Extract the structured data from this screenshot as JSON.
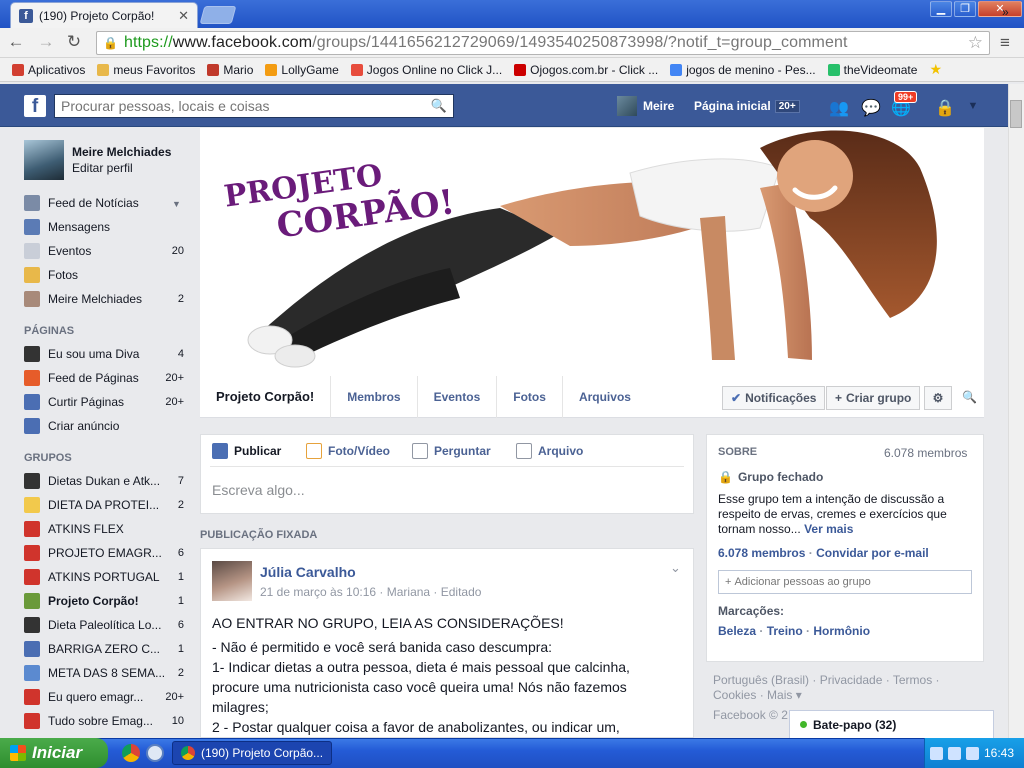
{
  "browser": {
    "tab_title": "(190) Projeto Corpão!",
    "url_https": "https://",
    "url_domain": "www.facebook.com",
    "url_path": "/groups/1441656212729069/1493540250873998/?notif_t=group_comment",
    "bookmarks": [
      {
        "label": "Aplicativos",
        "color": "#d23f31"
      },
      {
        "label": "meus Favoritos",
        "color": "#e8b84a"
      },
      {
        "label": "Mario",
        "color": "#c0392b"
      },
      {
        "label": "LollyGame",
        "color": "#f39c12"
      },
      {
        "label": "Jogos Online no Click J...",
        "color": "#e74c3c"
      },
      {
        "label": "Ojogos.com.br - Click ...",
        "color": "#cc0000"
      },
      {
        "label": "jogos de menino - Pes...",
        "color": "#4285f4"
      },
      {
        "label": "theVideomate",
        "color": "#27c06a"
      }
    ],
    "bookmarks_more": "»"
  },
  "fb": {
    "search_placeholder": "Procurar pessoas, locais e coisas",
    "user_short": "Meire",
    "home_label": "Página inicial",
    "home_count": "20+",
    "notif_badge": "99+"
  },
  "sidebar": {
    "name": "Meire Melchiades",
    "edit": "Editar perfil",
    "main": [
      {
        "label": "Feed de Notícias",
        "count": "",
        "icon": "news-feed-icon",
        "color": "#7b8ba6"
      },
      {
        "label": "Mensagens",
        "count": "",
        "icon": "messages-icon",
        "color": "#5b7bb5"
      },
      {
        "label": "Eventos",
        "count": "20",
        "icon": "calendar-icon",
        "color": "#c9ced8"
      },
      {
        "label": "Fotos",
        "count": "",
        "icon": "photos-icon",
        "color": "#e8b84a"
      },
      {
        "label": "Meire Melchiades",
        "count": "2",
        "icon": "profile-icon",
        "color": "#a88a7a"
      }
    ],
    "pages_head": "PÁGINAS",
    "pages": [
      {
        "label": "Eu sou uma Diva",
        "count": "4",
        "icon": "page-diva-icon",
        "color": "#333333"
      },
      {
        "label": "Feed de Páginas",
        "count": "20+",
        "icon": "flag-icon",
        "color": "#e65c2a"
      },
      {
        "label": "Curtir Páginas",
        "count": "20+",
        "icon": "like-icon",
        "color": "#4b6eb3"
      },
      {
        "label": "Criar anúncio",
        "count": "",
        "icon": "chart-icon",
        "color": "#4b6eb3"
      }
    ],
    "groups_head": "GRUPOS",
    "groups": [
      {
        "label": "Dietas Dukan e Atk...",
        "count": "7",
        "icon": "graduation-cap-icon",
        "color": "#333333",
        "bold": false
      },
      {
        "label": "DIETA DA PROTEI...",
        "count": "2",
        "icon": "lightbulb-icon",
        "color": "#f2c94c",
        "bold": false
      },
      {
        "label": "ATKINS FLEX",
        "count": "",
        "icon": "apple-icon",
        "color": "#d0342c",
        "bold": false
      },
      {
        "label": "PROJETO EMAGR...",
        "count": "6",
        "icon": "apple-icon",
        "color": "#d0342c",
        "bold": false
      },
      {
        "label": "ATKINS PORTUGAL",
        "count": "1",
        "icon": "apple-icon",
        "color": "#d0342c",
        "bold": false
      },
      {
        "label": "Projeto Corpão!",
        "count": "1",
        "icon": "plant-icon",
        "color": "#6a9a3a",
        "bold": true
      },
      {
        "label": "Dieta Paleolítica Lo...",
        "count": "6",
        "icon": "graduation-cap-icon",
        "color": "#333333",
        "bold": false
      },
      {
        "label": "BARRIGA ZERO C...",
        "count": "1",
        "icon": "group-icon",
        "color": "#4b6eb3",
        "bold": false
      },
      {
        "label": "META DAS 8 SEMA...",
        "count": "2",
        "icon": "flask-icon",
        "color": "#5b8ad0",
        "bold": false
      },
      {
        "label": "Eu quero emagr...",
        "count": "20+",
        "icon": "apple-icon",
        "color": "#d0342c",
        "bold": false
      },
      {
        "label": "Tudo sobre Emag...",
        "count": "10",
        "icon": "apple-icon",
        "color": "#d0342c",
        "bold": false
      }
    ]
  },
  "cover": {
    "title_line1": "PROJETO",
    "title_line2": "CORPÃO!"
  },
  "group_tabs": {
    "name": "Projeto Corpão!",
    "items": [
      "Membros",
      "Eventos",
      "Fotos",
      "Arquivos"
    ],
    "notifications": "Notificações",
    "create_group": "Criar grupo"
  },
  "composer": {
    "tabs": [
      "Publicar",
      "Foto/Vídeo",
      "Perguntar",
      "Arquivo"
    ],
    "placeholder": "Escreva algo..."
  },
  "pinned_label": "PUBLICAÇÃO FIXADA",
  "post": {
    "author": "Júlia Carvalho",
    "meta": "21 de março às 10:16 · Mariana · Editado",
    "lines": [
      "AO ENTRAR NO GRUPO, LEIA AS CONSIDERAÇÕES!",
      "- Não é permitido e você será banida caso descumpra:",
      "1- Indicar dietas a outra pessoa, dieta é mais pessoal que calcinha,",
      "procure uma nutricionista caso você queira uma! Nós não fazemos",
      "milagres;",
      "2 - Postar qualquer coisa a favor de anabolizantes, ou indicar um,"
    ]
  },
  "about": {
    "head": "SOBRE",
    "members_count": "6.078 membros",
    "closed": "Grupo fechado",
    "desc_lines": [
      "Esse grupo tem a intenção de discussão a",
      "respeito de ervas, cremes e exercícios que",
      "tornam nosso..."
    ],
    "see_more": "Ver mais",
    "members_link": "6.078 membros",
    "invite": "Convidar por e-mail",
    "add_placeholder": "Adicionar pessoas ao grupo",
    "tags_head": "Marcações:",
    "tags": [
      "Beleza",
      "Treino",
      "Hormônio"
    ]
  },
  "footer": {
    "line1": "Português (Brasil) · Privacidade · Termos ·",
    "line2": "Cookies · Mais ▾",
    "line3": "Facebook © 2"
  },
  "chat": {
    "label": "Bate-papo (32)"
  },
  "taskbar": {
    "start": "Iniciar",
    "item": "(190) Projeto Corpão...",
    "time": "16:43"
  }
}
